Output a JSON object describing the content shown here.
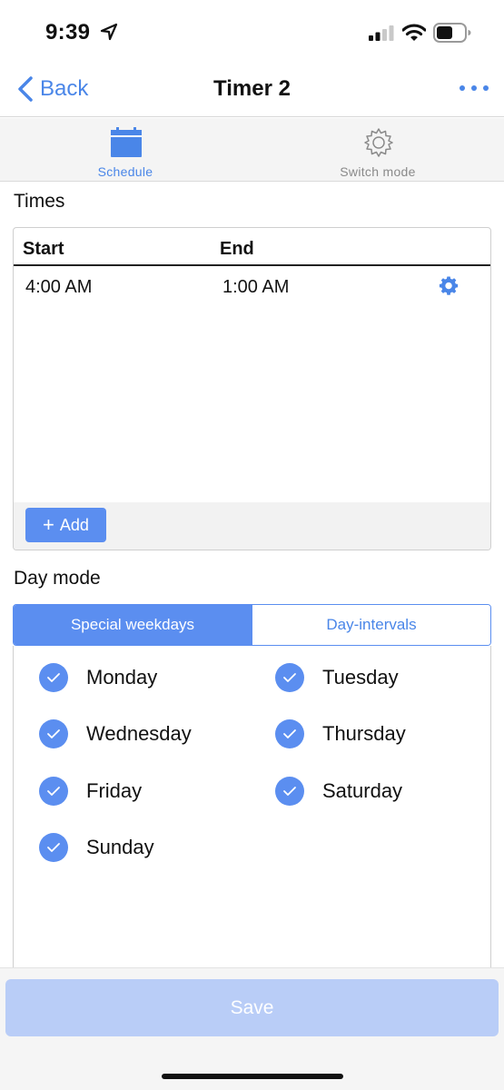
{
  "status_bar": {
    "time": "9:39",
    "icons": [
      "location-arrow-icon",
      "cellular-signal-icon",
      "wifi-icon",
      "battery-icon"
    ]
  },
  "nav": {
    "back_label": "Back",
    "title": "Timer 2",
    "more_icon": "more-dots-icon"
  },
  "tabs": [
    {
      "label": "Schedule",
      "icon": "calendar-icon",
      "active": true
    },
    {
      "label": "Switch mode",
      "icon": "gear-icon",
      "active": false
    }
  ],
  "times": {
    "heading": "Times",
    "columns": {
      "start": "Start",
      "end": "End"
    },
    "rows": [
      {
        "start": "4:00 AM",
        "end": "1:00 AM",
        "icon": "gear-icon"
      }
    ],
    "add_label": "Add",
    "add_icon": "plus-icon"
  },
  "day_mode": {
    "heading": "Day mode",
    "segments": [
      "Special weekdays",
      "Day-intervals"
    ],
    "selected_segment": "Special weekdays",
    "days": [
      {
        "label": "Monday",
        "checked": true
      },
      {
        "label": "Tuesday",
        "checked": true
      },
      {
        "label": "Wednesday",
        "checked": true
      },
      {
        "label": "Thursday",
        "checked": true
      },
      {
        "label": "Friday",
        "checked": true
      },
      {
        "label": "Saturday",
        "checked": true
      },
      {
        "label": "Sunday",
        "checked": true
      }
    ]
  },
  "save_label": "Save",
  "colors": {
    "accent": "#5b8ef0",
    "link": "#4a86e8",
    "save_disabled": "#b9cdf7"
  }
}
